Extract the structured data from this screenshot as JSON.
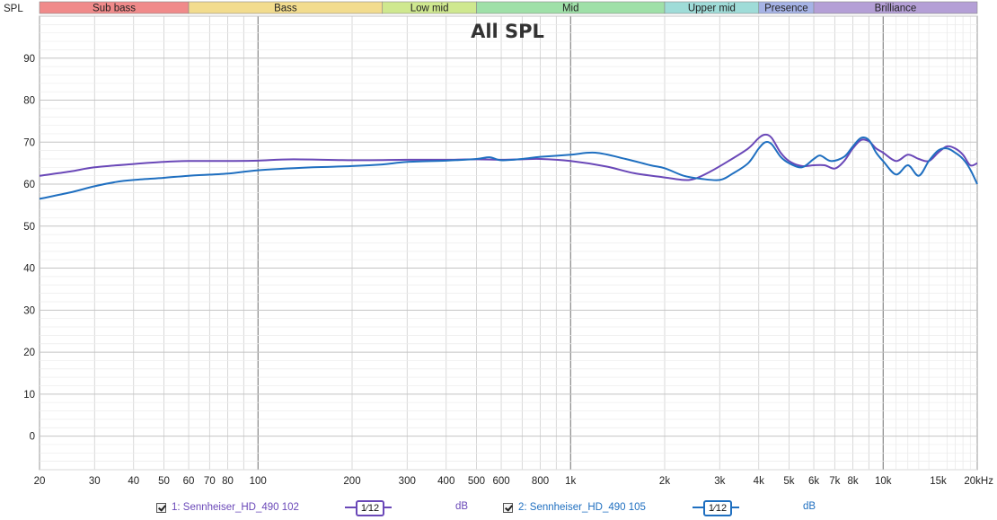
{
  "chart_data": {
    "type": "line",
    "title": "All SPL",
    "ylabel": "SPL",
    "xscale": "log",
    "xlim": [
      20,
      20000
    ],
    "ylim": [
      -8,
      100
    ],
    "yticks": [
      0,
      10,
      20,
      30,
      40,
      50,
      60,
      70,
      80,
      90
    ],
    "xticks": [
      {
        "v": 20,
        "l": "20"
      },
      {
        "v": 30,
        "l": "30"
      },
      {
        "v": 40,
        "l": "40"
      },
      {
        "v": 50,
        "l": "50"
      },
      {
        "v": 60,
        "l": "60"
      },
      {
        "v": 70,
        "l": "70"
      },
      {
        "v": 80,
        "l": "80"
      },
      {
        "v": 100,
        "l": "100"
      },
      {
        "v": 200,
        "l": "200"
      },
      {
        "v": 300,
        "l": "300"
      },
      {
        "v": 400,
        "l": "400"
      },
      {
        "v": 500,
        "l": "500"
      },
      {
        "v": 600,
        "l": "600"
      },
      {
        "v": 800,
        "l": "800"
      },
      {
        "v": 1000,
        "l": "1k"
      },
      {
        "v": 2000,
        "l": "2k"
      },
      {
        "v": 3000,
        "l": "3k"
      },
      {
        "v": 4000,
        "l": "4k"
      },
      {
        "v": 5000,
        "l": "5k"
      },
      {
        "v": 6000,
        "l": "6k"
      },
      {
        "v": 7000,
        "l": "7k"
      },
      {
        "v": 8000,
        "l": "8k"
      },
      {
        "v": 10000,
        "l": "10k"
      },
      {
        "v": 15000,
        "l": "15k"
      },
      {
        "v": 20000,
        "l": "20kHz"
      }
    ],
    "bands": [
      {
        "name": "Sub bass",
        "from": 20,
        "to": 60,
        "color": "#f08a8a"
      },
      {
        "name": "Bass",
        "from": 60,
        "to": 250,
        "color": "#f2dc8e"
      },
      {
        "name": "Low mid",
        "from": 250,
        "to": 500,
        "color": "#cfe88f"
      },
      {
        "name": "Mid",
        "from": 500,
        "to": 2000,
        "color": "#9fe0a8"
      },
      {
        "name": "Upper mid",
        "from": 2000,
        "to": 4000,
        "color": "#9fdcd8"
      },
      {
        "name": "Presence",
        "from": 4000,
        "to": 6000,
        "color": "#a6b3e6"
      },
      {
        "name": "Brilliance",
        "from": 6000,
        "to": 20000,
        "color": "#b49fd6"
      }
    ],
    "grid": true,
    "legend_position": "bottom",
    "series": [
      {
        "name": "1: Sennheiser_HD_490 102",
        "color": "#6a48b8",
        "points": [
          [
            20,
            62.0
          ],
          [
            25,
            63.0
          ],
          [
            30,
            64.0
          ],
          [
            40,
            64.8
          ],
          [
            50,
            65.3
          ],
          [
            60,
            65.5
          ],
          [
            80,
            65.5
          ],
          [
            100,
            65.6
          ],
          [
            130,
            65.9
          ],
          [
            200,
            65.7
          ],
          [
            300,
            65.8
          ],
          [
            400,
            65.8
          ],
          [
            500,
            65.9
          ],
          [
            600,
            65.8
          ],
          [
            700,
            65.9
          ],
          [
            800,
            66.0
          ],
          [
            1000,
            65.5
          ],
          [
            1300,
            64.2
          ],
          [
            1600,
            62.6
          ],
          [
            2000,
            61.6
          ],
          [
            2300,
            61.0
          ],
          [
            2500,
            61.3
          ],
          [
            2800,
            63.0
          ],
          [
            3200,
            65.5
          ],
          [
            3700,
            68.5
          ],
          [
            4000,
            71.0
          ],
          [
            4200,
            71.8
          ],
          [
            4400,
            71.0
          ],
          [
            4700,
            67.5
          ],
          [
            5000,
            65.5
          ],
          [
            5500,
            64.3
          ],
          [
            6000,
            64.5
          ],
          [
            6500,
            64.5
          ],
          [
            7000,
            63.7
          ],
          [
            7500,
            65.5
          ],
          [
            8000,
            68.5
          ],
          [
            8500,
            70.5
          ],
          [
            9000,
            70.2
          ],
          [
            9500,
            68.5
          ],
          [
            10000,
            67.5
          ],
          [
            11000,
            65.5
          ],
          [
            12000,
            67.0
          ],
          [
            13000,
            66.0
          ],
          [
            14000,
            65.5
          ],
          [
            15000,
            67.5
          ],
          [
            16000,
            69.0
          ],
          [
            17000,
            68.5
          ],
          [
            18000,
            67.0
          ],
          [
            19000,
            64.5
          ],
          [
            20000,
            65.0
          ]
        ]
      },
      {
        "name": "2: Sennheiser_HD_490 105",
        "color": "#1f6fc0",
        "points": [
          [
            20,
            56.5
          ],
          [
            25,
            58.0
          ],
          [
            30,
            59.5
          ],
          [
            35,
            60.5
          ],
          [
            40,
            61.0
          ],
          [
            50,
            61.5
          ],
          [
            60,
            62.0
          ],
          [
            80,
            62.5
          ],
          [
            100,
            63.3
          ],
          [
            150,
            64.0
          ],
          [
            200,
            64.3
          ],
          [
            250,
            64.7
          ],
          [
            300,
            65.3
          ],
          [
            400,
            65.6
          ],
          [
            500,
            66.0
          ],
          [
            550,
            66.4
          ],
          [
            600,
            65.7
          ],
          [
            700,
            66.0
          ],
          [
            800,
            66.5
          ],
          [
            1000,
            67.0
          ],
          [
            1200,
            67.5
          ],
          [
            1500,
            66.0
          ],
          [
            1800,
            64.5
          ],
          [
            2000,
            63.8
          ],
          [
            2300,
            62.0
          ],
          [
            2600,
            61.3
          ],
          [
            3000,
            61.0
          ],
          [
            3300,
            62.5
          ],
          [
            3700,
            65.0
          ],
          [
            4000,
            68.5
          ],
          [
            4200,
            70.0
          ],
          [
            4400,
            69.5
          ],
          [
            4700,
            66.5
          ],
          [
            5000,
            65.0
          ],
          [
            5500,
            64.0
          ],
          [
            6000,
            66.0
          ],
          [
            6300,
            66.8
          ],
          [
            6800,
            65.5
          ],
          [
            7500,
            66.5
          ],
          [
            8000,
            69.0
          ],
          [
            8500,
            71.0
          ],
          [
            9000,
            70.5
          ],
          [
            9500,
            67.5
          ],
          [
            10000,
            65.5
          ],
          [
            11000,
            62.3
          ],
          [
            12000,
            64.5
          ],
          [
            13000,
            62.0
          ],
          [
            14000,
            65.5
          ],
          [
            15000,
            68.0
          ],
          [
            16000,
            68.5
          ],
          [
            17000,
            67.5
          ],
          [
            18000,
            66.0
          ],
          [
            19000,
            63.5
          ],
          [
            20000,
            60.0
          ]
        ]
      }
    ]
  },
  "legend": {
    "items": [
      {
        "label": "1: Sennheiser_HD_490 102",
        "smoothing": "1⁄12",
        "unit": "dB",
        "color": "#6a48b8"
      },
      {
        "label": "2: Sennheiser_HD_490 105",
        "smoothing": "1⁄12",
        "unit": "dB",
        "color": "#1f6fc0"
      }
    ]
  }
}
